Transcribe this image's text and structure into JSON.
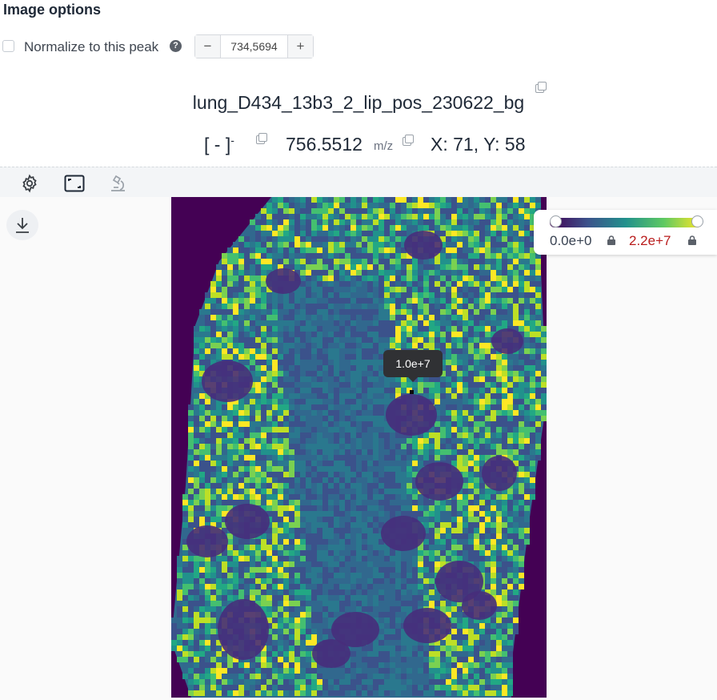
{
  "image_options": {
    "title": "Image options",
    "normalize_label": "Normalize to this peak",
    "help_icon": "question-circle-icon",
    "stepper": {
      "decrement": "−",
      "value": "734,5694",
      "increment": "+"
    }
  },
  "dataset": {
    "name": "lung_D434_13b3_2_lip_pos_230622_bg"
  },
  "ion": {
    "formula": "[ - ]",
    "charge": "-",
    "mz": "756.5512",
    "mz_unit": "m/z",
    "coords": "X: 71, Y: 58"
  },
  "toolbar": {
    "icons": [
      "gear-icon",
      "fit-to-screen-icon",
      "microscope-icon"
    ]
  },
  "viewer": {
    "download_icon": "download-icon"
  },
  "colorbar": {
    "min_label": "0.0e+0",
    "max_label": "2.2e+7",
    "colormap": "viridis",
    "colors": [
      "#440154",
      "#3b528b",
      "#21918c",
      "#5ec962",
      "#fde725"
    ],
    "max_label_color": "#b91c1c"
  },
  "tooltip": {
    "value": "1.0e+7"
  }
}
